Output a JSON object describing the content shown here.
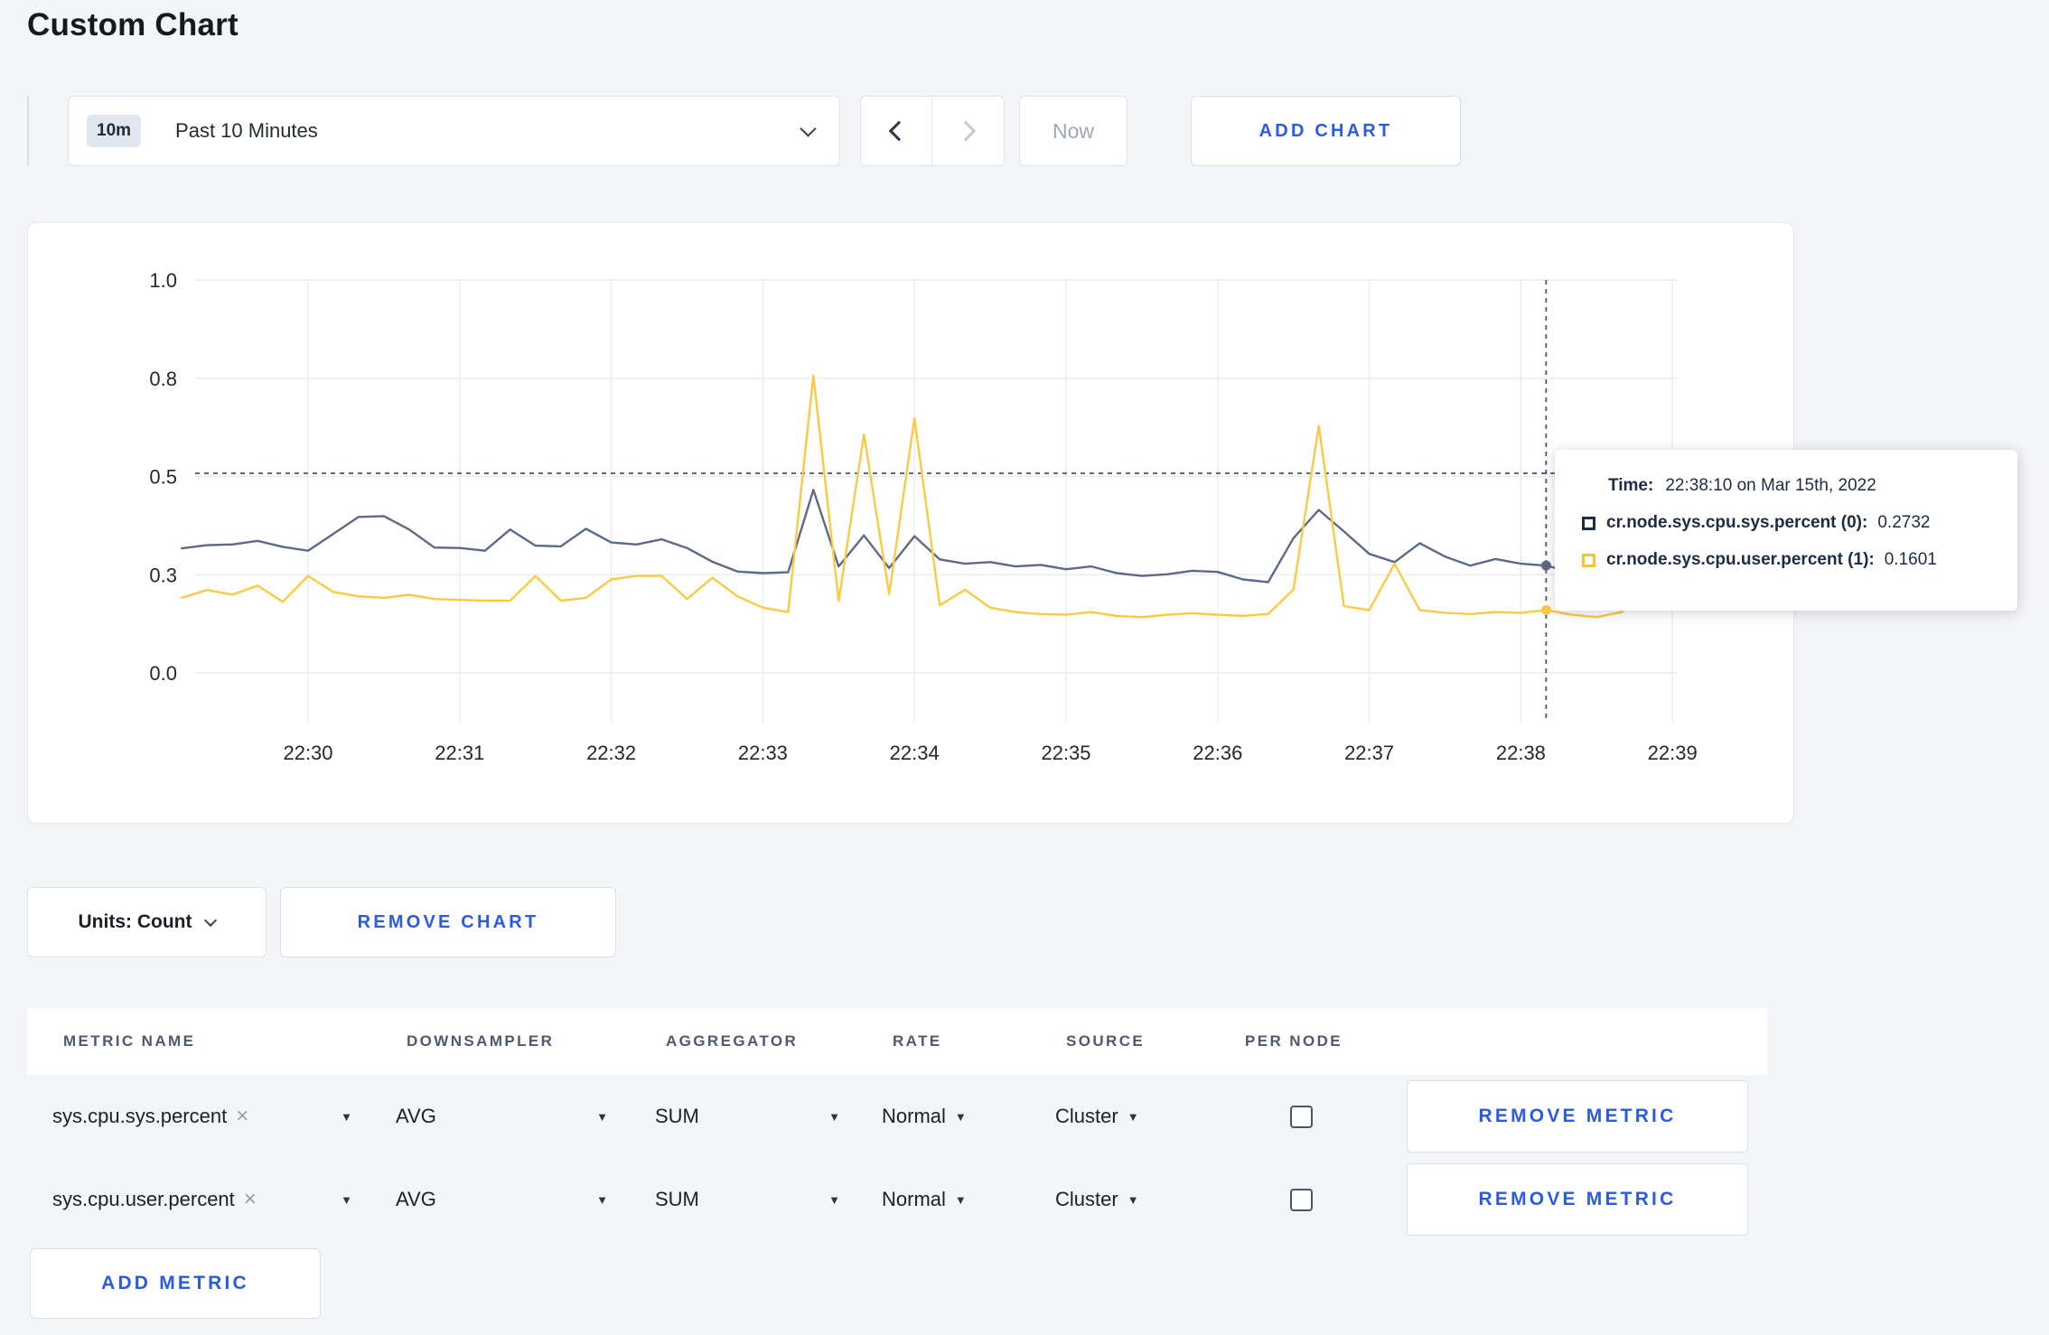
{
  "page": {
    "title": "Custom Chart"
  },
  "toolbar": {
    "time_window_badge": "10m",
    "time_window_label": "Past 10 Minutes",
    "now_label": "Now",
    "add_chart_label": "ADD CHART"
  },
  "chart_controls": {
    "units_label": "Units: Count",
    "remove_chart_label": "REMOVE CHART"
  },
  "tooltip": {
    "time_label": "Time:",
    "time_value": "22:38:10 on Mar 15th, 2022",
    "series": [
      {
        "name": "cr.node.sys.cpu.sys.percent (0):",
        "value": "0.2732",
        "color": "#1e2c49"
      },
      {
        "name": "cr.node.sys.cpu.user.percent (1):",
        "value": "0.1601",
        "color": "#fdc12c"
      }
    ]
  },
  "metrics_table": {
    "headers": [
      "METRIC NAME",
      "DOWNSAMPLER",
      "AGGREGATOR",
      "RATE",
      "SOURCE",
      "PER NODE"
    ],
    "rows": [
      {
        "metric": "sys.cpu.sys.percent",
        "downsampler": "AVG",
        "aggregator": "SUM",
        "rate": "Normal",
        "source": "Cluster",
        "per_node": false,
        "remove_label": "REMOVE METRIC"
      },
      {
        "metric": "sys.cpu.user.percent",
        "downsampler": "AVG",
        "aggregator": "SUM",
        "rate": "Normal",
        "source": "Cluster",
        "per_node": false,
        "remove_label": "REMOVE METRIC"
      }
    ],
    "add_metric_label": "ADD METRIC"
  },
  "chart_data": {
    "type": "line",
    "title": "",
    "xlabel": "",
    "ylabel": "",
    "ylim": [
      0,
      1
    ],
    "grid": true,
    "legend_position": "tooltip",
    "x_ticks": [
      "22:30",
      "22:31",
      "22:32",
      "22:33",
      "22:34",
      "22:35",
      "22:36",
      "22:37",
      "22:38",
      "22:39"
    ],
    "y_ticks": [
      {
        "value": 0,
        "label": "0.0"
      },
      {
        "value": 0.25,
        "label": "0.3"
      },
      {
        "value": 0.5,
        "label": "0.5"
      },
      {
        "value": 0.75,
        "label": "0.8"
      },
      {
        "value": 1,
        "label": "1.0"
      }
    ],
    "x": [
      "22:29:10",
      "22:29:20",
      "22:29:30",
      "22:29:40",
      "22:29:50",
      "22:30:00",
      "22:30:10",
      "22:30:20",
      "22:30:30",
      "22:30:40",
      "22:30:50",
      "22:31:00",
      "22:31:10",
      "22:31:20",
      "22:31:30",
      "22:31:40",
      "22:31:50",
      "22:32:00",
      "22:32:10",
      "22:32:20",
      "22:32:30",
      "22:32:40",
      "22:32:50",
      "22:33:00",
      "22:33:10",
      "22:33:20",
      "22:33:30",
      "22:33:40",
      "22:33:50",
      "22:34:00",
      "22:34:10",
      "22:34:20",
      "22:34:30",
      "22:34:40",
      "22:34:50",
      "22:35:00",
      "22:35:10",
      "22:35:20",
      "22:35:30",
      "22:35:40",
      "22:35:50",
      "22:36:00",
      "22:36:10",
      "22:36:20",
      "22:36:30",
      "22:36:40",
      "22:36:50",
      "22:37:00",
      "22:37:10",
      "22:37:20",
      "22:37:30",
      "22:37:40",
      "22:37:50",
      "22:38:00",
      "22:38:10",
      "22:38:20",
      "22:38:30",
      "22:38:40",
      "22:38:50",
      "22:39:00"
    ],
    "series": [
      {
        "name": "cr.node.sys.cpu.sys.percent (0)",
        "color": "#5c6a85",
        "values": [
          0.317,
          0.325,
          0.327,
          0.336,
          0.321,
          0.311,
          0.354,
          0.397,
          0.399,
          0.365,
          0.319,
          0.318,
          0.311,
          0.365,
          0.324,
          0.322,
          0.367,
          0.332,
          0.327,
          0.34,
          0.318,
          0.283,
          0.258,
          0.254,
          0.256,
          0.466,
          0.271,
          0.35,
          0.267,
          0.348,
          0.289,
          0.278,
          0.282,
          0.271,
          0.275,
          0.264,
          0.271,
          0.254,
          0.247,
          0.251,
          0.26,
          0.257,
          0.238,
          0.231,
          0.343,
          0.415,
          0.36,
          0.303,
          0.282,
          0.33,
          0.296,
          0.273,
          0.29,
          0.278,
          0.2732,
          0.257,
          0.254,
          0.271,
          0.289,
          0.277
        ]
      },
      {
        "name": "cr.node.sys.cpu.user.percent (1)",
        "color": "#fbca42",
        "values": [
          0.191,
          0.211,
          0.199,
          0.222,
          0.181,
          0.247,
          0.206,
          0.195,
          0.191,
          0.199,
          0.188,
          0.186,
          0.184,
          0.184,
          0.247,
          0.184,
          0.191,
          0.238,
          0.247,
          0.247,
          0.188,
          0.242,
          0.195,
          0.166,
          0.155,
          0.757,
          0.183,
          0.607,
          0.2,
          0.648,
          0.172,
          0.212,
          0.166,
          0.155,
          0.15,
          0.148,
          0.155,
          0.145,
          0.142,
          0.148,
          0.152,
          0.148,
          0.145,
          0.15,
          0.212,
          0.629,
          0.17,
          0.16,
          0.278,
          0.16,
          0.153,
          0.15,
          0.155,
          0.153,
          0.1601,
          0.148,
          0.142,
          0.155,
          0.245,
          0.205
        ]
      }
    ],
    "crosshair": {
      "time": "22:38:10",
      "index": 54,
      "y_guide": 0.508
    }
  }
}
